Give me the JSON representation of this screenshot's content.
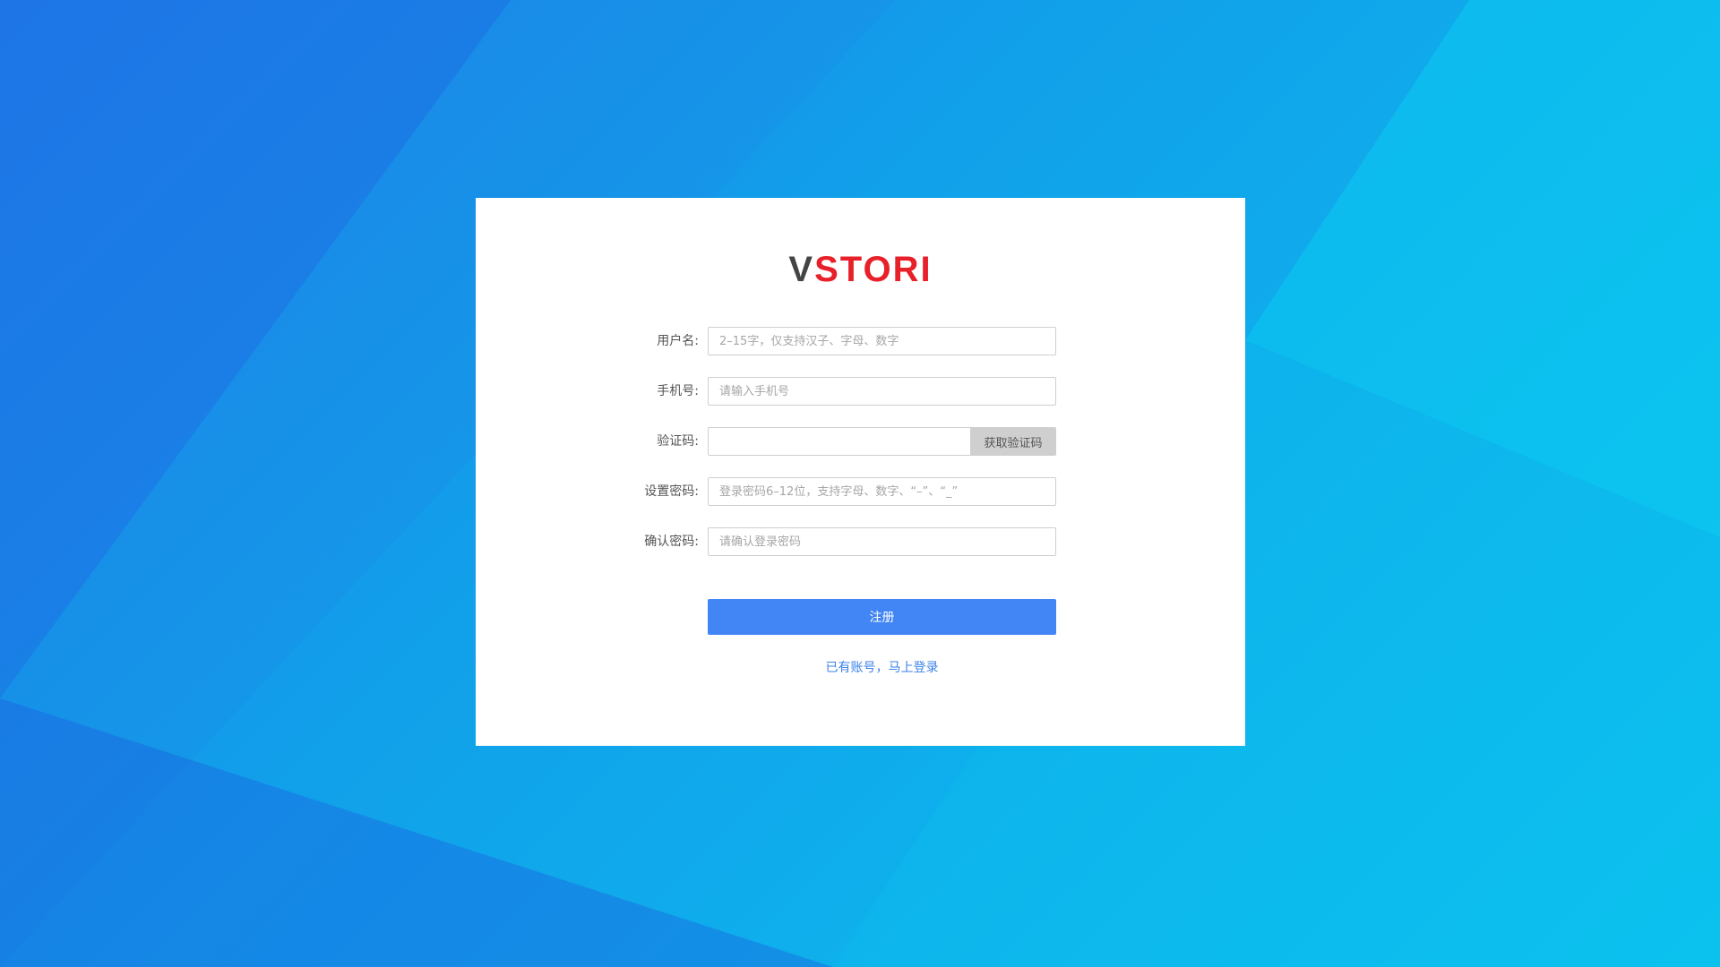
{
  "brand": {
    "logo_first": "V",
    "logo_rest": "STORI",
    "logo_first_color": "#444444",
    "logo_rest_color": "#e8202a"
  },
  "form": {
    "username": {
      "label": "用户名:",
      "placeholder": "2–15字，仅支持汉子、字母、数字"
    },
    "phone": {
      "label": "手机号:",
      "placeholder": "请输入手机号"
    },
    "code": {
      "label": "验证码:",
      "placeholder": "",
      "button": "获取验证码"
    },
    "password": {
      "label": "设置密码:",
      "placeholder": "登录密码6–12位，支持字母、数字、“–”、“_”"
    },
    "confirm": {
      "label": "确认密码:",
      "placeholder": "请确认登录密码"
    },
    "submit_label": "注册",
    "login_link": "已有账号，马上登录"
  },
  "colors": {
    "primary": "#4285f4",
    "link": "#3b82e8",
    "background_start": "#1f7ee8",
    "background_end": "#0cc3ef"
  }
}
